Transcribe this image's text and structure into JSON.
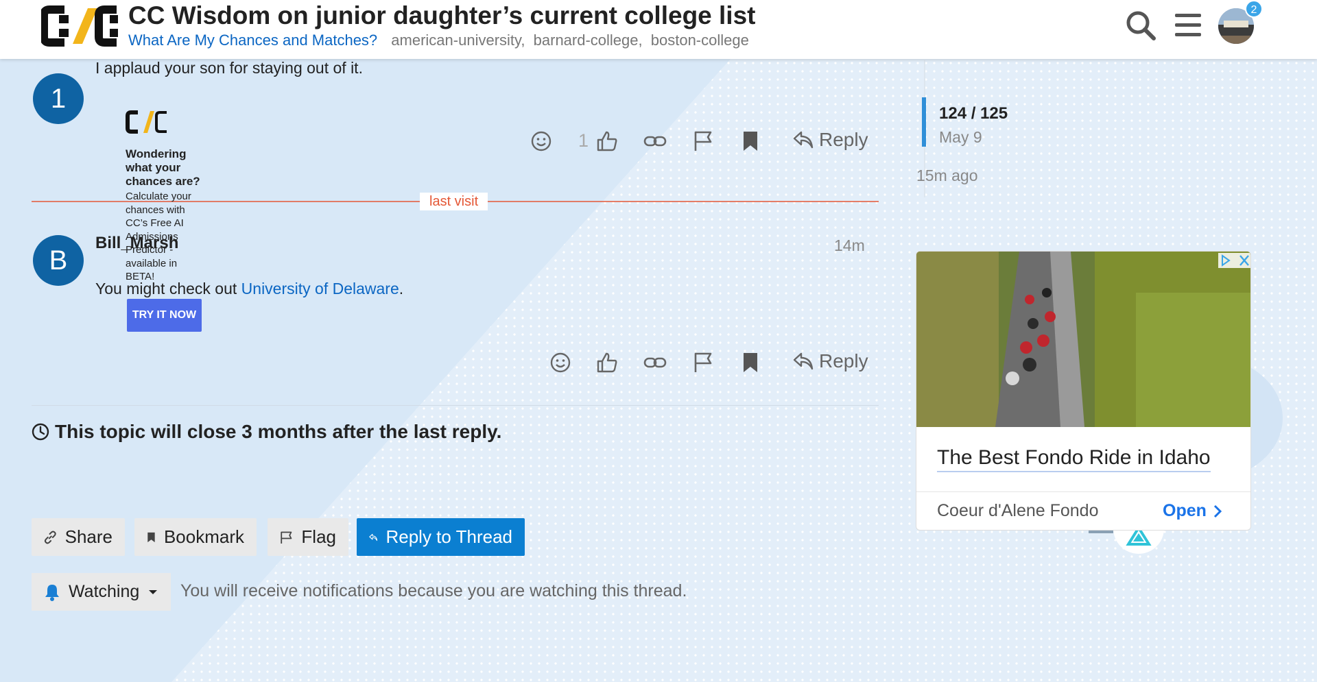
{
  "header": {
    "title": "CC Wisdom on junior daughter’s current college list",
    "category": "What Are My Chances and Matches?",
    "tags": [
      "american-university,",
      "barnard-college,",
      "boston-college"
    ],
    "notification_count": "2"
  },
  "posts": [
    {
      "avatar_letter": "1",
      "text": "I applaud your son for staying out of it.",
      "like_count": "1",
      "reply_label": "Reply"
    },
    {
      "avatar_letter": "B",
      "author": "Bill_Marsh",
      "time": "14m",
      "text_before": "You might check out ",
      "link_text": "University of Delaware",
      "text_after": ".",
      "reply_label": "Reply"
    }
  ],
  "last_visit_label": "last visit",
  "cc_ad": {
    "title": "Wondering what your chances are?",
    "body": "Calculate your chances with CC’s Free AI Admissions Predictor - available in BETA!",
    "button": "TRY IT NOW"
  },
  "close_note": "This topic will close 3 months after the last reply.",
  "footer": {
    "share": "Share",
    "bookmark": "Bookmark",
    "flag": "Flag",
    "reply_thread": "Reply to Thread",
    "watching": "Watching",
    "watching_note": "You will receive notifications because you are watching this thread."
  },
  "timeline": {
    "count": "124 / 125",
    "date": "May 9",
    "ago": "15m ago"
  },
  "side_ad": {
    "title": "The Best Fondo Ride in Idaho",
    "source": "Coeur d'Alene Fondo",
    "open_label": "Open"
  },
  "colors": {
    "brand_blue": "#0b66c3",
    "avatar_blue": "#0f63a3",
    "primary_button": "#0b7fd1",
    "last_visit": "#e45735"
  }
}
